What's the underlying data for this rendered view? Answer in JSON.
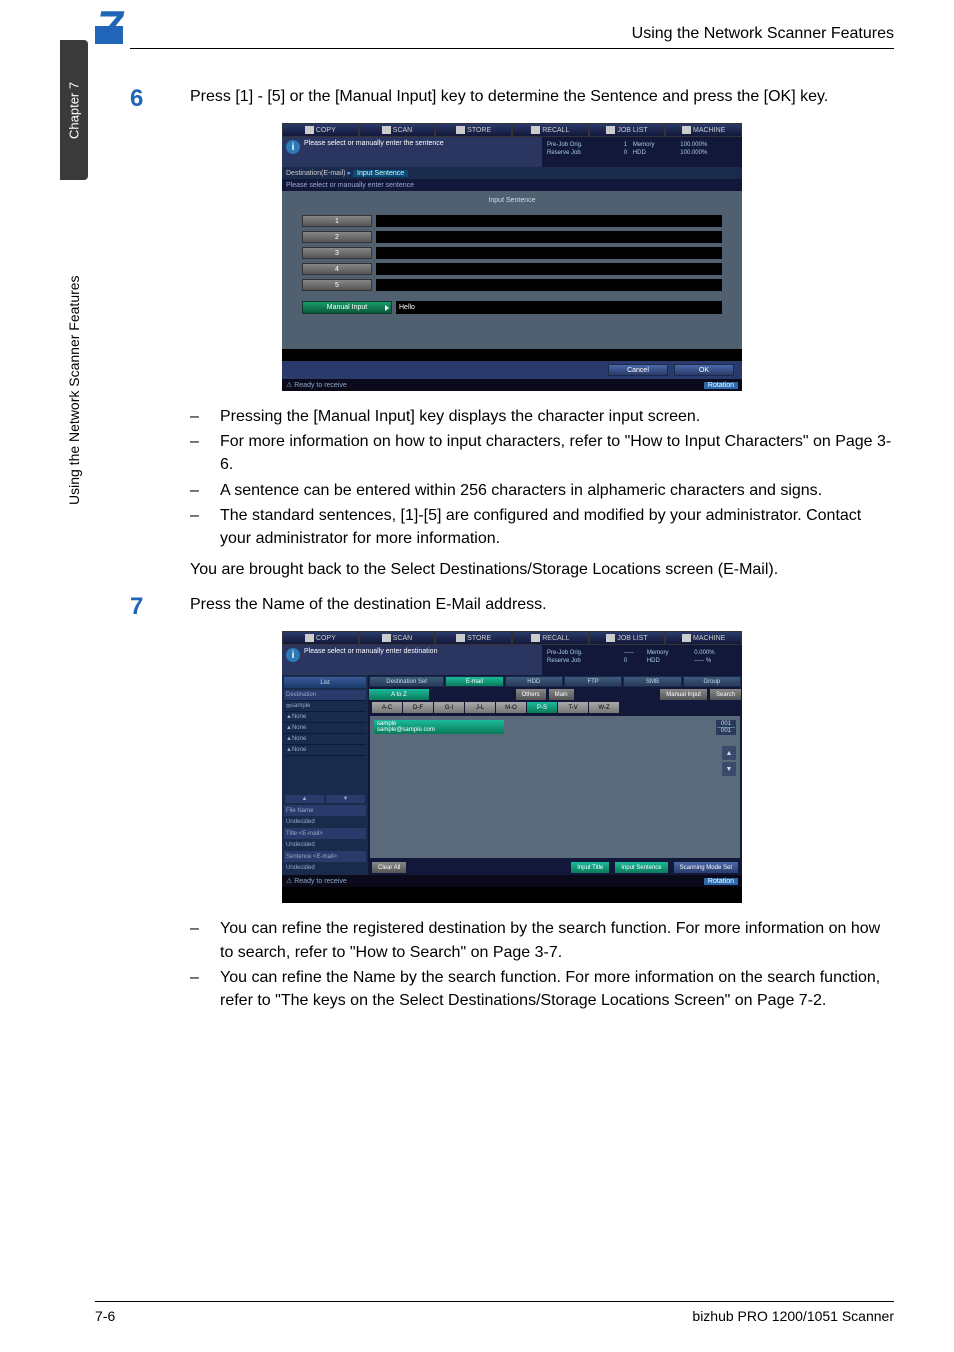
{
  "sidebar": {
    "chapter": "Chapter 7",
    "section": "Using the Network Scanner Features"
  },
  "header": {
    "chapnum": "7",
    "title": "Using the Network Scanner Features"
  },
  "step6": {
    "num": "6",
    "text": "Press [1] - [5] or the [Manual Input] key to determine the Sentence and press the [OK] key."
  },
  "ss1": {
    "tabs": [
      "COPY",
      "SCAN",
      "STORE",
      "RECALL",
      "JOB LIST",
      "MACHINE"
    ],
    "hdr_msg": "Please select or manually enter the sentence",
    "status_pre": "Pre-Job Orig.",
    "status_prev": "1",
    "status_mem": "Memory",
    "status_memv": "100.000%",
    "status_res": "Reserve Job",
    "status_resv": "0",
    "status_hdd": "HDD",
    "status_hddv": "100.000%",
    "crumb1": "Destination(E-mail)",
    "crumb2": "Input Sentence",
    "subtitle": "Please select or manually enter sentence",
    "input_sentence": "Input Sentence",
    "nums": [
      "1",
      "2",
      "3",
      "4",
      "5"
    ],
    "manual": "Manual Input",
    "hello": "Hello",
    "cancel": "Cancel",
    "ok": "OK",
    "ready": "Ready to receive",
    "rotation": "Rotation"
  },
  "bullets1": {
    "b1": "Pressing the [Manual Input] key displays the character input screen.",
    "b2": "For more information on how to input characters, refer to \"How to Input Characters\" on Page 3-6.",
    "b3": "A sentence can be entered within 256 characters in alphameric characters and signs.",
    "b4": "The standard sentences, [1]-[5] are configured and modified by your administrator. Contact your administrator for more information."
  },
  "para1": "You are brought back to the Select Destinations/Storage Locations screen (E-Mail).",
  "step7": {
    "num": "7",
    "text": "Press the Name of the destination E-Mail address."
  },
  "ss2": {
    "tabs": [
      "COPY",
      "SCAN",
      "STORE",
      "RECALL",
      "JOB LIST",
      "MACHINE"
    ],
    "hdr_msg": "Please select or manually enter destination",
    "status_pre": "Pre-Job Orig.",
    "status_prev": "-----",
    "status_mem": "Memory",
    "status_memv": "0.000%",
    "status_res": "Reserve Job",
    "status_resv": "0",
    "status_hdd": "HDD",
    "status_hddv": "----- %",
    "list": "List",
    "left_dest": "Destination",
    "left_items": [
      "sample",
      "None",
      "None",
      "None",
      "None"
    ],
    "file_name": "File Name",
    "undecided": "Undecided",
    "title_email": "Title <E-mail>",
    "sentence_email": "Sentence <E-mail>",
    "destset": "Destination Set",
    "tabs2": [
      "E-mail",
      "HDD",
      "FTP",
      "SMB",
      "Group"
    ],
    "atoz": "A to Z",
    "others": "Others",
    "main": "Main",
    "manual": "Manual Input",
    "search": "Search",
    "alpha": [
      "A-C",
      "D-F",
      "G-I",
      "J-L",
      "M-O",
      "P-S",
      "T-V",
      "W-Z"
    ],
    "sample_name": "sample",
    "sample_addr": "sample@sample.com",
    "count1": "001",
    "count2": "001",
    "clear": "Clear All",
    "input_title": "Input Title",
    "input_sentence": "Input Sentence",
    "scanmode": "Scanning Mode Set",
    "ready": "Ready to receive",
    "rotation": "Rotation"
  },
  "bullets2": {
    "b1": "You can refine the registered destination by the search function. For more information on how to search, refer to \"How to Search\" on Page 3-7.",
    "b2": "You can refine the Name by the search function. For more information on the search function, refer to \"The keys on the Select Destinations/Storage Locations Screen\" on Page 7-2."
  },
  "footer": {
    "left": "7-6",
    "right": "bizhub PRO 1200/1051 Scanner"
  }
}
